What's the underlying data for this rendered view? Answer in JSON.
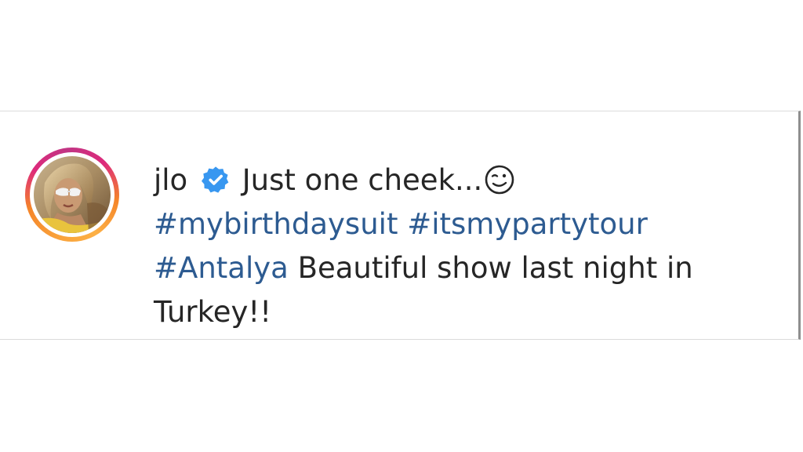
{
  "post_caption": {
    "username": "jlo",
    "verified_icon": "verified-badge-icon",
    "text_intro": "Just one cheek...",
    "emoji_icon": "winking-face-emoji",
    "hashtags": [
      "#mybirthdaysuit",
      "#itsmypartytour",
      "#Antalya"
    ],
    "text_body": "Beautiful show last night in Turkey!!"
  },
  "colors": {
    "hashtag": "#2d5b91",
    "text": "#262626",
    "verified_badge": "#3897f0",
    "ring_start": "#f58529",
    "ring_end": "#c13584"
  }
}
